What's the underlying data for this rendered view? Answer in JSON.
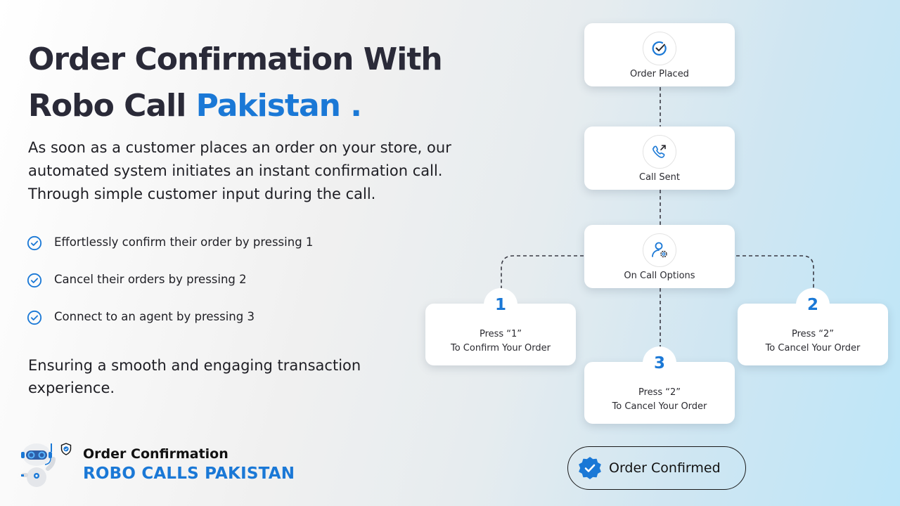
{
  "headline": {
    "line1": "Order Confirmation With",
    "line2_plain": "Robo Call ",
    "line2_accent": "Pakistan",
    "line2_end": " ."
  },
  "intro": "As soon as a customer places an order on your store, our automated system initiates an instant confirmation call. Through simple customer input during the call.",
  "features": [
    {
      "icon": "check-circle-icon",
      "text": "Effortlessly confirm their order by pressing 1"
    },
    {
      "icon": "check-circle-icon",
      "text": "Cancel their orders by pressing 2"
    },
    {
      "icon": "check-circle-icon",
      "text": "Connect to an agent by pressing 3"
    }
  ],
  "outro": "Ensuring a smooth and engaging transaction experience.",
  "brand": {
    "title": "Order Confirmation",
    "subtitle": "ROBO CALLS PAKISTAN",
    "logo_icon": "robot-icon",
    "badge_icon": "shield-check-icon"
  },
  "flow": {
    "steps": [
      {
        "icon": "check-circle-icon",
        "label": "Order Placed"
      },
      {
        "icon": "phone-outgoing-icon",
        "label": "Call Sent"
      },
      {
        "icon": "user-gear-icon",
        "label": "On Call Options"
      }
    ],
    "options": [
      {
        "number": "1",
        "line1": "Press “1”",
        "line2": "To Confirm Your Order"
      },
      {
        "number": "2",
        "line1": "Press “2”",
        "line2": "To Cancel Your Order"
      },
      {
        "number": "3",
        "line1": "Press “2”",
        "line2": "To Cancel Your Order"
      }
    ],
    "result": {
      "icon": "verified-badge-icon",
      "label": "Order Confirmed"
    }
  },
  "colors": {
    "accent": "#1a78d6",
    "heading": "#2a2a38",
    "text": "#1e1e24"
  }
}
